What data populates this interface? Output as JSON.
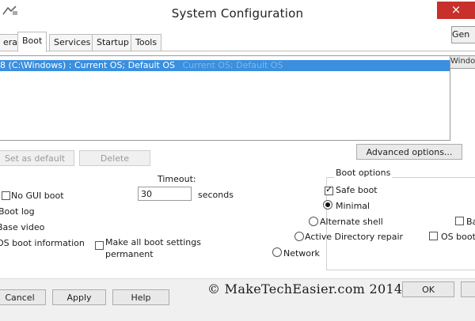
{
  "window": {
    "title": "System Configuration",
    "close_glyph": "×",
    "general_button_fragment": "Gen"
  },
  "tabs": [
    {
      "label": "eral"
    },
    {
      "label": "Boot"
    },
    {
      "label": "Services"
    },
    {
      "label": "Startup"
    },
    {
      "label": "Tools"
    }
  ],
  "os_list": {
    "selected_entry": "8 (C:\\Windows) : Current OS; Default OS",
    "faint_tail": "Current OS; Default OS",
    "right_fragment": "Windows"
  },
  "list_buttons": {
    "set_default": "Set as default",
    "delete": "Delete",
    "advanced": "Advanced options..."
  },
  "left_options": {
    "no_gui_boot": "No GUI boot",
    "boot_log": "Boot log",
    "base_video": "Base video",
    "os_boot_information": "OS boot information"
  },
  "timeout": {
    "label": "Timeout:",
    "value": "30",
    "unit": "seconds"
  },
  "make_permanent": {
    "label_line1": "Make all boot settings",
    "label_line2": "permanent",
    "checked": false
  },
  "boot_options": {
    "group_label": "Boot options",
    "safe_boot": {
      "label": "Safe boot",
      "checked": true
    },
    "minimal": {
      "label": "Minimal",
      "selected": true
    },
    "alternate_shell": {
      "label": "Alternate shell",
      "selected": false
    },
    "active_directory_repair": {
      "label": "Active Directory repair",
      "selected": false
    },
    "network": {
      "label": "Network",
      "selected": false
    },
    "right_base": "Base",
    "right_os_boot": "OS boot"
  },
  "bottom_buttons": {
    "cancel": "Cancel",
    "apply": "Apply",
    "help": "Help",
    "ok": "OK"
  },
  "watermark": "© MakeTechEasier.com 2014"
}
